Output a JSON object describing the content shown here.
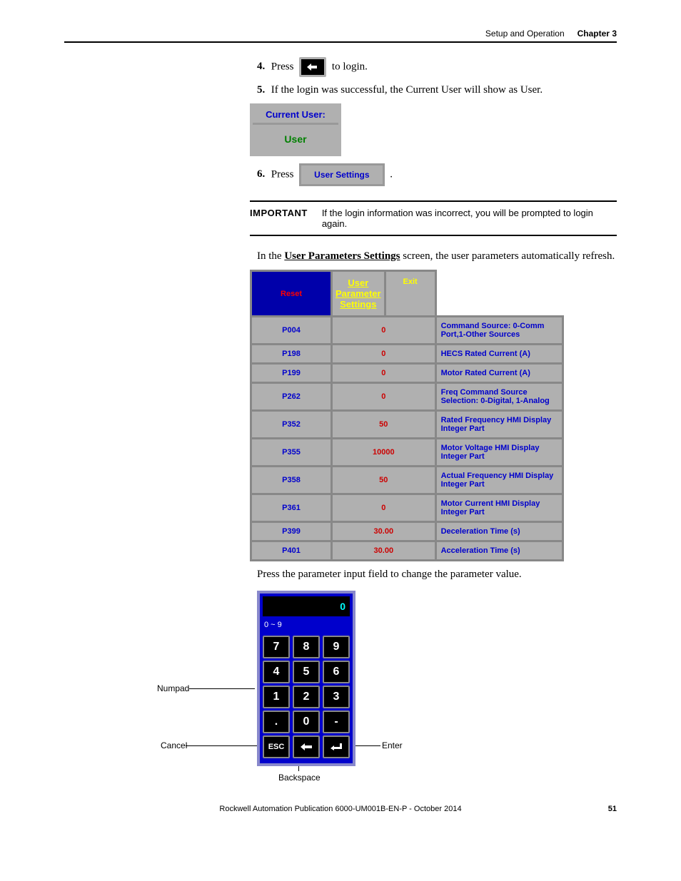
{
  "header": {
    "section": "Setup and Operation",
    "chapter": "Chapter 3"
  },
  "steps": {
    "s4_num": "4.",
    "s4_pre": "Press",
    "s4_post": "to login.",
    "s5_num": "5.",
    "s5_text": "If the login was successful, the Current User will show as User.",
    "s6_num": "6.",
    "s6_pre": "Press",
    "s6_post": "."
  },
  "current_user": {
    "label": "Current User:",
    "value": "User"
  },
  "user_settings_btn": "User Settings",
  "important": {
    "label": "IMPORTANT",
    "text": "If the login information was incorrect, you will be prompted to login again."
  },
  "body1_pre": "In the ",
  "body1_link": "User Parameters Settings",
  "body1_post": " screen, the user parameters automatically refresh.",
  "params": {
    "reset": "Reset",
    "title": "User Parameter Settings",
    "exit": "Exit",
    "rows": [
      {
        "code": "P004",
        "val": "0",
        "desc": "Command Source: 0-Comm Port,1-Other Sources"
      },
      {
        "code": "P198",
        "val": "0",
        "desc": "HECS Rated Current (A)"
      },
      {
        "code": "P199",
        "val": "0",
        "desc": "Motor Rated Current (A)"
      },
      {
        "code": "P262",
        "val": "0",
        "desc": "Freq Command Source Selection: 0-Digital, 1-Analog"
      },
      {
        "code": "P352",
        "val": "50",
        "desc": "Rated Frequency HMI Display Integer Part"
      },
      {
        "code": "P355",
        "val": "10000",
        "desc": "Motor Voltage HMI Display Integer Part"
      },
      {
        "code": "P358",
        "val": "50",
        "desc": "Actual Frequency HMI Display Integer Part"
      },
      {
        "code": "P361",
        "val": "0",
        "desc": "Motor Current HMI Display Integer Part"
      },
      {
        "code": "P399",
        "val": "30.00",
        "desc": "Deceleration Time (s)"
      },
      {
        "code": "P401",
        "val": "30.00",
        "desc": "Acceleration Time (s)"
      }
    ]
  },
  "body2": "Press the parameter input field to change the parameter value.",
  "numpad": {
    "display": "0",
    "range": "0 ~ 9",
    "keys": {
      "k7": "7",
      "k8": "8",
      "k9": "9",
      "k4": "4",
      "k5": "5",
      "k6": "6",
      "k1": "1",
      "k2": "2",
      "k3": "3",
      "kdot": ".",
      "k0": "0",
      "kminus": "-",
      "kesc": "ESC"
    }
  },
  "callouts": {
    "numpad": "Numpad",
    "cancel": "Cancel",
    "backspace": "Backspace",
    "enter": "Enter"
  },
  "footer": {
    "text": "Rockwell Automation Publication 6000-UM001B-EN-P - October 2014",
    "page": "51"
  }
}
